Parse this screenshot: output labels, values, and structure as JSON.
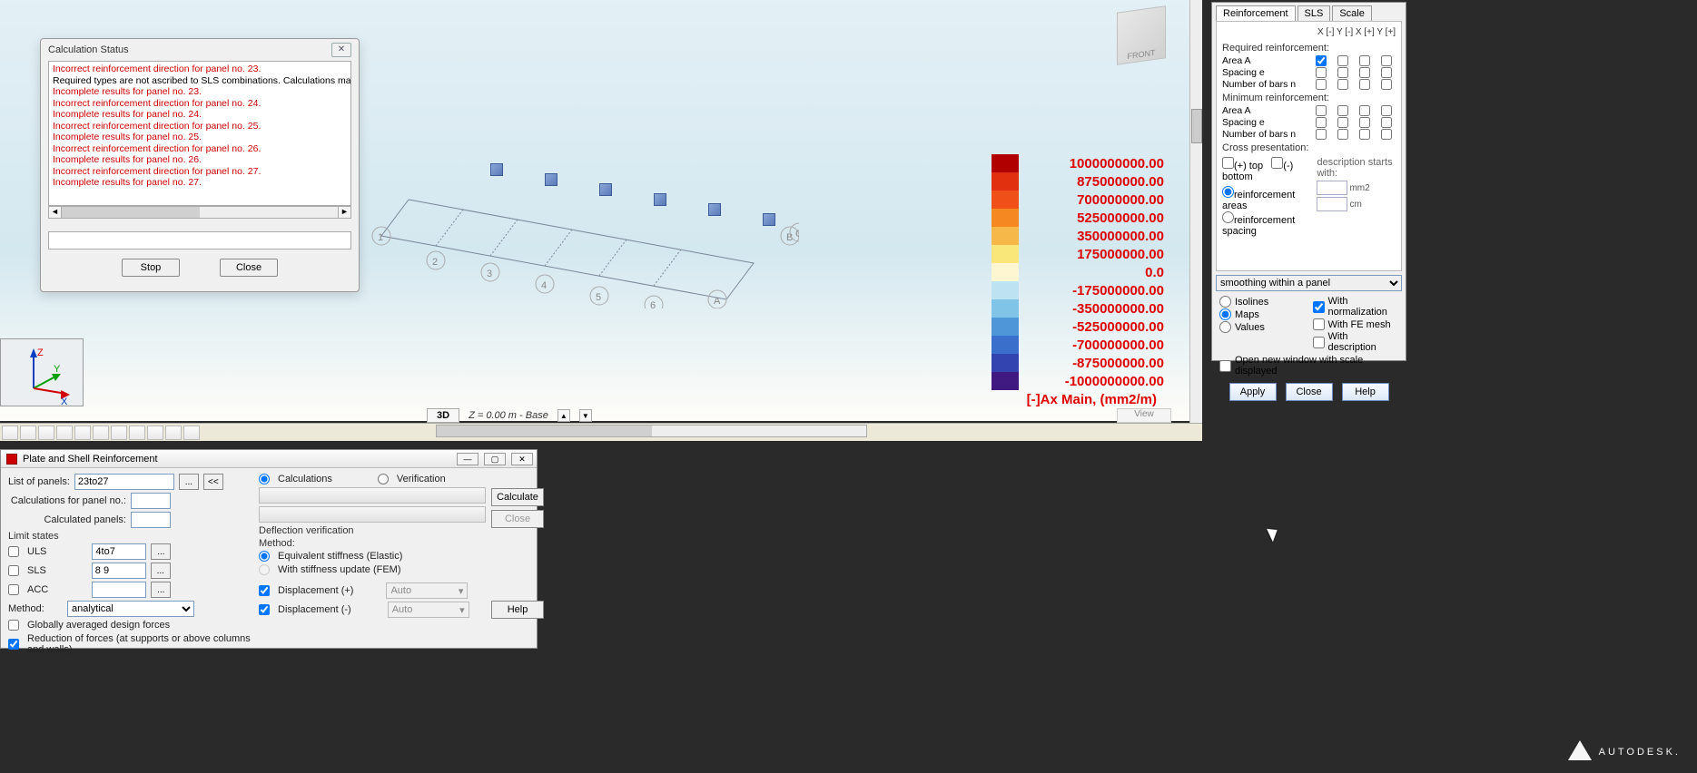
{
  "calc_status": {
    "title": "Calculation Status",
    "messages": [
      {
        "text": "Incorrect reinforcement direction for panel no. 23.",
        "type": "err"
      },
      {
        "text": "Required types are not ascribed to SLS combinations. Calculations may be incom",
        "type": "warn"
      },
      {
        "text": "Incomplete results for panel no. 23.",
        "type": "err"
      },
      {
        "text": "Incorrect reinforcement direction for panel no. 24.",
        "type": "err"
      },
      {
        "text": "Incomplete results for panel no. 24.",
        "type": "err"
      },
      {
        "text": "Incorrect reinforcement direction for panel no. 25.",
        "type": "err"
      },
      {
        "text": "Incomplete results for panel no. 25.",
        "type": "err"
      },
      {
        "text": "Incorrect reinforcement direction for panel no. 26.",
        "type": "err"
      },
      {
        "text": "Incomplete results for panel no. 26.",
        "type": "err"
      },
      {
        "text": "Incorrect reinforcement direction for panel no. 27.",
        "type": "err"
      },
      {
        "text": "Incomplete results for panel no. 27.",
        "type": "err"
      }
    ],
    "stop": "Stop",
    "close": "Close"
  },
  "legend": {
    "values": [
      "1000000000.00",
      "875000000.00",
      "700000000.00",
      "525000000.00",
      "350000000.00",
      "175000000.00",
      "0.0",
      "-175000000.00",
      "-350000000.00",
      "-525000000.00",
      "-700000000.00",
      "-875000000.00",
      "-1000000000.00"
    ],
    "colors": [
      "#b00000",
      "#e03010",
      "#f05018",
      "#f58820",
      "#f6b848",
      "#f9e77a",
      "#fdf6d0",
      "#bde2f2",
      "#80c4e8",
      "#4f96d8",
      "#3a6fcc",
      "#3344b0",
      "#401a80"
    ],
    "caption": "[-]Ax Main, (mm2/m)"
  },
  "status3d": {
    "mode": "3D",
    "coords": "Z = 0.00 m",
    "base": "- Base"
  },
  "view_label": "View",
  "viewcube": "FRONT",
  "axes": [
    "1",
    "2",
    "3",
    "4",
    "5",
    "6",
    "A",
    "B",
    "C"
  ],
  "triad": {
    "z": "Z",
    "y": "Y",
    "x": "X"
  },
  "psr": {
    "title": "Plate and Shell Reinforcement",
    "list_of_panels_label": "List of panels:",
    "list_of_panels": "23to27",
    "calculations": "Calculations",
    "verification": "Verification",
    "calc_for_panel_label": "Calculations for panel no.:",
    "calculated_panels_label": "Calculated panels:",
    "calculate": "Calculate",
    "close": "Close",
    "help": "Help",
    "limit_states": "Limit states",
    "uls": "ULS",
    "sls": "SLS",
    "acc": "ACC",
    "uls_val": "4to7",
    "sls_val": "8 9",
    "acc_val": "",
    "method_label": "Method:",
    "method": "analytical",
    "globally_avg": "Globally averaged design forces",
    "reduction": "Reduction of forces (at supports or above columns and walls)",
    "deflection_header": "Deflection verification",
    "deflection_method": "Method:",
    "eq_stiff": "Equivalent stiffness (Elastic)",
    "fem_stiff": "With stiffness update (FEM)",
    "disp_plus": "Displacement (+)",
    "disp_minus": "Displacement (-)",
    "auto": "Auto"
  },
  "reinf": {
    "tabs": [
      "Reinforcement",
      "SLS",
      "Scale"
    ],
    "header_cols": "X [-] Y [-] X [+] Y [+]",
    "required": "Required reinforcement:",
    "minimum": "Minimum reinforcement:",
    "rows": [
      "Area A",
      "Spacing e",
      "Number of bars n"
    ],
    "cross_presentation": "Cross presentation:",
    "plus_top": "(+) top",
    "minus_bottom": "(-) bottom",
    "desc_starts": "description starts with:",
    "reinf_areas": "reinforcement areas",
    "unit_mm2": "mm2",
    "reinf_spacing": "reinforcement spacing",
    "unit_cm": "cm",
    "smoothing": "smoothing within a panel",
    "isolines": "Isolines",
    "maps": "Maps",
    "values": "Values",
    "with_norm": "With normalization",
    "with_fe": "With FE mesh",
    "with_desc": "With description",
    "open_new": "Open new window with scale displayed",
    "apply": "Apply",
    "close": "Close",
    "help": "Help"
  },
  "brand": "AUTODESK."
}
